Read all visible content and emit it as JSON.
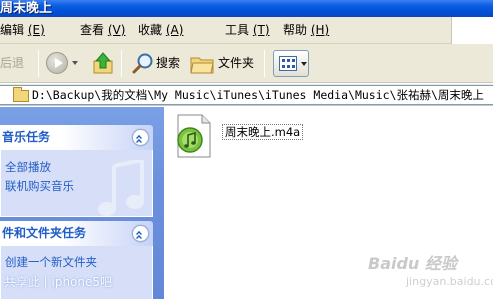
{
  "window": {
    "title": "周末晚上"
  },
  "menubar": {
    "items": [
      {
        "label": "编辑",
        "accel": "(E)"
      },
      {
        "label": "查看",
        "accel": "(V)"
      },
      {
        "label": "收藏",
        "accel": "(A)"
      },
      {
        "label": "工具",
        "accel": "(T)"
      },
      {
        "label": "帮助",
        "accel": "(H)"
      }
    ]
  },
  "toolbar": {
    "back_label": "后退",
    "search_label": "搜索",
    "folders_label": "文件夹"
  },
  "address": {
    "path": "D:\\Backup\\我的文档\\My Music\\iTunes\\iTunes Media\\Music\\张祐赫\\周末晚上"
  },
  "taskpane": {
    "music_tasks": {
      "title": "音乐任务",
      "links": [
        "全部播放",
        "联机购买音乐"
      ]
    },
    "file_tasks": {
      "title": "件和文件夹任务",
      "links": [
        "创建一个新文件夹"
      ]
    }
  },
  "files": [
    {
      "name": "周末晚上.m4a",
      "icon": "itunes-music-file-icon"
    }
  ],
  "watermarks": {
    "left": " 共享此 | iphone5吧",
    "right": "Baidu 经验",
    "right_sub": "jingyan.baidu.com"
  },
  "colors": {
    "title_bar": "#0054e3",
    "taskpane_bg": "#6d92df",
    "task_header_text": "#215dc6",
    "task_body": "#d6dff7",
    "chrome": "#ece9d8"
  }
}
